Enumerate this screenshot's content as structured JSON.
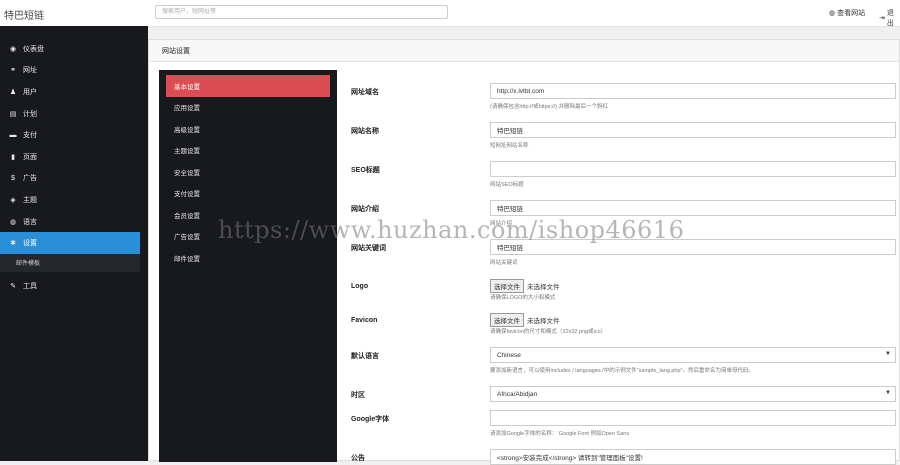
{
  "topbar": {
    "brand": "特巴短链",
    "search_placeholder": "搜索用户，短网址等",
    "view_site": "查看网站",
    "logout": "退出",
    "view_site_icon": "globe-icon",
    "logout_icon": "logout-icon"
  },
  "sidebar": {
    "items": [
      {
        "label": "仪表盘",
        "icon": "dashboard-icon",
        "glyph": "◉"
      },
      {
        "label": "网址",
        "icon": "link-icon",
        "glyph": "⚭"
      },
      {
        "label": "用户",
        "icon": "user-icon",
        "glyph": "♟"
      },
      {
        "label": "计划",
        "icon": "plan-icon",
        "glyph": "▤"
      },
      {
        "label": "支付",
        "icon": "payment-icon",
        "glyph": "▬"
      },
      {
        "label": "页面",
        "icon": "page-icon",
        "glyph": "▮"
      },
      {
        "label": "广告",
        "icon": "dollar-icon",
        "glyph": "$"
      },
      {
        "label": "主题",
        "icon": "theme-icon",
        "glyph": "◈"
      },
      {
        "label": "语言",
        "icon": "language-icon",
        "glyph": "◍"
      },
      {
        "label": "设置",
        "icon": "gear-icon",
        "glyph": "✱"
      }
    ],
    "sub_item": "邮件模板",
    "tools": {
      "label": "工具",
      "icon": "wrench-icon",
      "glyph": "✎"
    }
  },
  "panel": {
    "title": "网站设置"
  },
  "settings_nav": [
    "基本设置",
    "应用设置",
    "高级设置",
    "主题设置",
    "安全设置",
    "支付设置",
    "会员设置",
    "广告设置",
    "邮件设置"
  ],
  "form": {
    "site_url": {
      "label": "网址域名",
      "value": "http://x.lvtbt.com",
      "help": "(请确保包含http://或https://) 并删除最后一个斜杠"
    },
    "site_name": {
      "label": "网站名称",
      "value": "特巴短链",
      "help": "短网址网站名称"
    },
    "seo_title": {
      "label": "SEO标题",
      "value": "",
      "help": "网站SEO标题"
    },
    "site_desc": {
      "label": "网站介绍",
      "value": "特巴短链",
      "help": "网站介绍"
    },
    "site_keywords": {
      "label": "网站关键词",
      "value": "特巴短链",
      "help": "网站关键词"
    },
    "logo": {
      "label": "Logo",
      "button": "选择文件",
      "status": "未选择文件",
      "help": "请确保LOGO的大小和模式"
    },
    "favicon": {
      "label": "Favicon",
      "button": "选择文件",
      "status": "未选择文件",
      "help": "请确保favicon的尺寸和模式（32x32 png或ico）"
    },
    "language": {
      "label": "默认语言",
      "value": "Chinese",
      "help": "要添加新语言，可以使用includes / languages /中的示例文件\"sample_lang.php\"。然后重命名为简单母代码。"
    },
    "timezone": {
      "label": "时区",
      "value": "Africa/Abidjan"
    },
    "google_font": {
      "label": "Google字体",
      "value": "",
      "help": "请添加Google字体的名称：  Google Font  例如Open Sans"
    },
    "notice": {
      "label": "公告",
      "value": "<strong>安装完成</strong> 请转到\"管理面板\"设置!"
    }
  },
  "watermark": "https://www.huzhan.com/ishop46616"
}
